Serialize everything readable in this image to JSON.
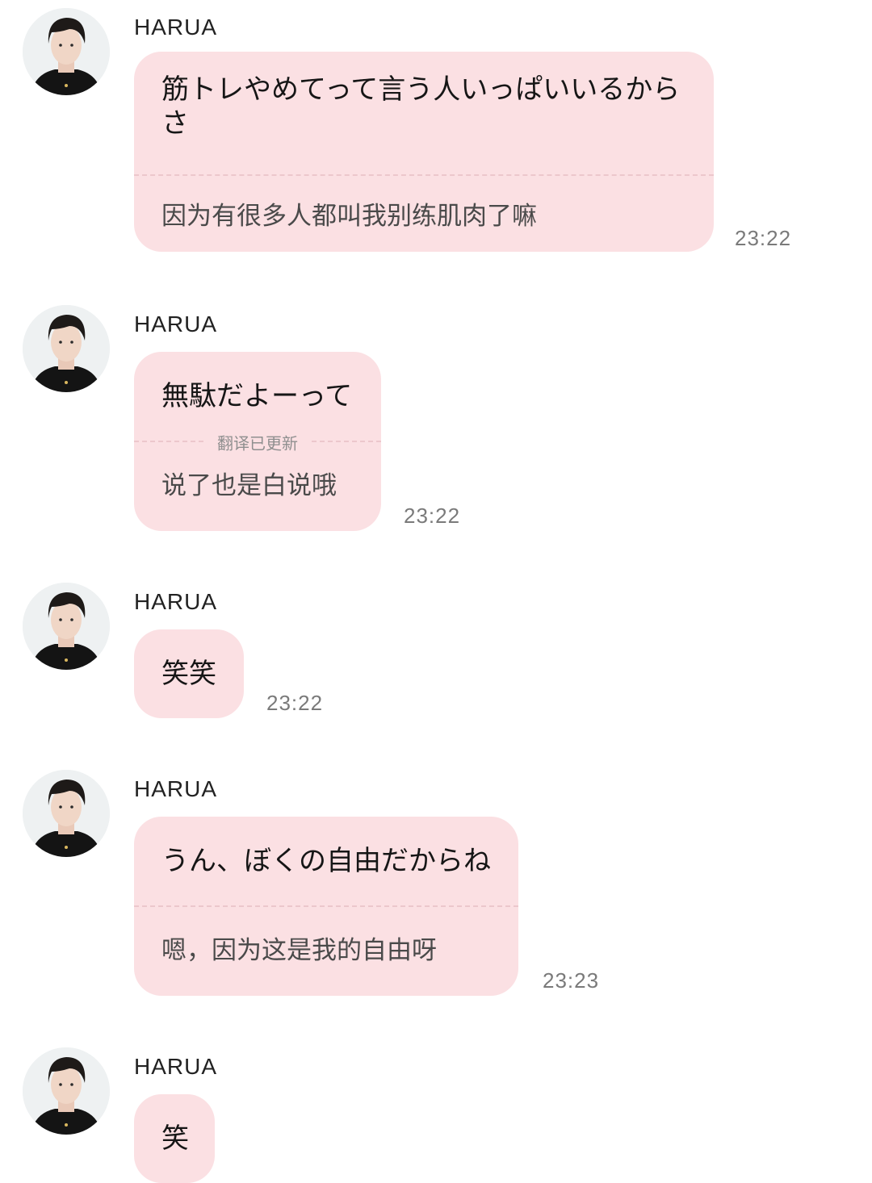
{
  "messages": [
    {
      "sender": "HARUA",
      "original": "筋トレやめてって言う人いっぱいいるからさ",
      "translation": "因为有很多人都叫我别练肌肉了嘛",
      "notice": "",
      "time": "23:22"
    },
    {
      "sender": "HARUA",
      "original": "無駄だよーって",
      "translation": "说了也是白说哦",
      "notice": "翻译已更新",
      "time": "23:22"
    },
    {
      "sender": "HARUA",
      "original": "笑笑",
      "translation": "",
      "notice": "",
      "time": "23:22"
    },
    {
      "sender": "HARUA",
      "original": "うん、ぼくの自由だからね",
      "translation": "嗯，因为这是我的自由呀",
      "notice": "",
      "time": "23:23"
    },
    {
      "sender": "HARUA",
      "original": "笑",
      "translation": "",
      "notice": "",
      "time": ""
    }
  ],
  "icons": {
    "avatar": "profile-photo-icon"
  },
  "colors": {
    "bubble": "#fbe0e3",
    "background": "#ffffff"
  }
}
